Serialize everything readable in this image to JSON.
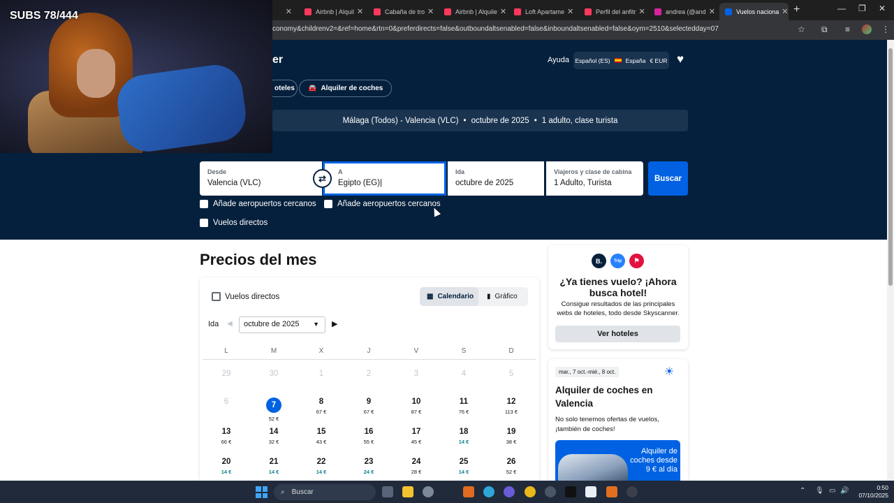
{
  "browser": {
    "tabs": [
      {
        "label": "ntr",
        "color": "#9aa0a6",
        "active": false
      },
      {
        "label": "Airbnb | Alquil",
        "color": "#ff385c",
        "active": false
      },
      {
        "label": "Cabaña de tro",
        "color": "#ff385c",
        "active": false
      },
      {
        "label": "Airbnb | Alquile",
        "color": "#ff385c",
        "active": false
      },
      {
        "label": "Loft Apartame",
        "color": "#ff385c",
        "active": false
      },
      {
        "label": "Perfil del anfitr",
        "color": "#ff385c",
        "active": false
      },
      {
        "label": "andrea (@and",
        "color": "#d6249f",
        "active": false
      },
      {
        "label": "Vuelos naciona",
        "color": "#0062e3",
        "active": true
      }
    ],
    "url": "conomy&childrenv2=&ref=home&rtn=0&preferdirects=false&outboundaltsenabled=false&inboundaltsenabled=false&oym=2510&selectedday=07"
  },
  "overlay": {
    "subs_text": "SUBS 78/444"
  },
  "header": {
    "logo_partial": "er",
    "help": "Ayuda",
    "locale": "Español (ES)",
    "country": "España",
    "currency": "€ EUR",
    "nav_hotels": "oteles",
    "nav_cars": "Alquiler de coches"
  },
  "summary": {
    "route": "Málaga (Todos) - Valencia (VLC)",
    "dot1": "•",
    "date": "octubre de 2025",
    "dot2": "•",
    "travellers": "1 adulto, clase turista"
  },
  "search": {
    "from_label": "Desde",
    "from_value": "Valencia (VLC)",
    "to_label": "A",
    "to_value": "Egipto (EG)|",
    "depart_label": "Ida",
    "depart_value": "octubre de 2025",
    "travellers_label": "Viajeros y clase de cabina",
    "travellers_value": "1 Adulto, Turista",
    "search_button": "Buscar",
    "nearby_from": "Añade aeropuertos cercanos",
    "nearby_to": "Añade aeropuertos cercanos",
    "direct": "Vuelos directos"
  },
  "month_prices": {
    "title": "Precios del mes",
    "direct": "Vuelos directos",
    "view_calendar": "Calendario",
    "view_chart": "Gráfico",
    "ida": "Ida",
    "month": "octubre de 2025",
    "weekdays": [
      "L",
      "M",
      "X",
      "J",
      "V",
      "S",
      "D"
    ],
    "weeks": [
      [
        {
          "d": "29",
          "p": "",
          "dim": true
        },
        {
          "d": "30",
          "p": "",
          "dim": true
        },
        {
          "d": "1",
          "p": "",
          "dim": true
        },
        {
          "d": "2",
          "p": "",
          "dim": true
        },
        {
          "d": "3",
          "p": "",
          "dim": true
        },
        {
          "d": "4",
          "p": "",
          "dim": true
        },
        {
          "d": "5",
          "p": "",
          "dim": true
        }
      ],
      [
        {
          "d": "6",
          "p": "",
          "dim": true
        },
        {
          "d": "7",
          "p": "52 €",
          "sel": true
        },
        {
          "d": "8",
          "p": "67 €"
        },
        {
          "d": "9",
          "p": "67 €"
        },
        {
          "d": "10",
          "p": "87 €"
        },
        {
          "d": "11",
          "p": "76 €"
        },
        {
          "d": "12",
          "p": "113 €"
        }
      ],
      [
        {
          "d": "13",
          "p": "66 €"
        },
        {
          "d": "14",
          "p": "32 €"
        },
        {
          "d": "15",
          "p": "43 €"
        },
        {
          "d": "16",
          "p": "55 €"
        },
        {
          "d": "17",
          "p": "45 €"
        },
        {
          "d": "18",
          "p": "14 €",
          "green": true
        },
        {
          "d": "19",
          "p": "38 €"
        }
      ],
      [
        {
          "d": "20",
          "p": "14 €",
          "green": true
        },
        {
          "d": "21",
          "p": "14 €",
          "green": true
        },
        {
          "d": "22",
          "p": "14 €",
          "green": true
        },
        {
          "d": "23",
          "p": "24 €",
          "green": true
        },
        {
          "d": "24",
          "p": "28 €"
        },
        {
          "d": "25",
          "p": "14 €",
          "green": true
        },
        {
          "d": "26",
          "p": "52 €"
        }
      ]
    ]
  },
  "hotel_card": {
    "badges": [
      "B.",
      "Trip",
      "⚑"
    ],
    "title": "¿Ya tienes vuelo? ¡Ahora busca hotel!",
    "body": "Consigue resultados de las principales webs de hoteles, todo desde Skyscanner.",
    "button": "Ver hoteles"
  },
  "car_card": {
    "tag": "mar., 7 oct.-mié., 8 oct.",
    "title": "Alquiler de coches en Valencia",
    "body": "No solo tenemos ofertas de vuelos, ¡también de coches!",
    "promo": "Alquiler de coches desde 9 € al día"
  },
  "taskbar": {
    "search": "Buscar",
    "time": "0:50",
    "date": "07/10/2025"
  }
}
